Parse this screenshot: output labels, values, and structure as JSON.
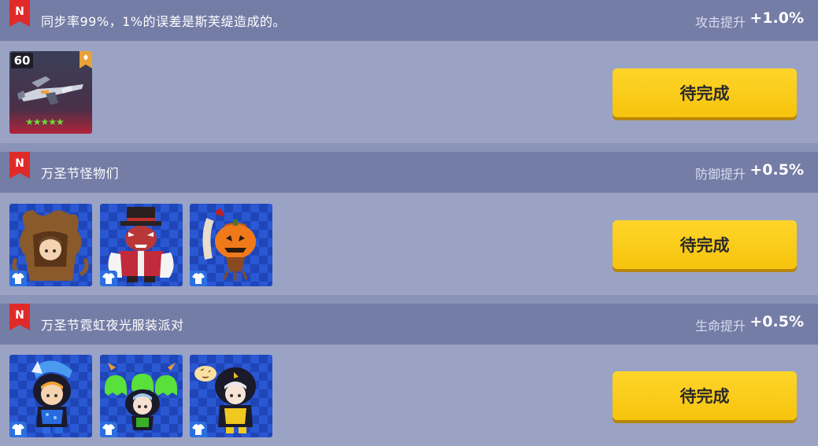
{
  "colors": {
    "header": "#737da6",
    "body": "#9aa3c4",
    "button": "#ffd52a",
    "flag": "#e02a2a"
  },
  "flag_letter": "N",
  "tasks": [
    {
      "title": "同步率99%，1%的误差是斯芙缇造成的。",
      "bonus_label": "攻击提升",
      "bonus_value": "+1.0%",
      "button_label": "待完成",
      "item": {
        "level": "60",
        "stars": "★★★★★",
        "icon": "weapon-icon"
      }
    },
    {
      "title": "万圣节怪物们",
      "bonus_label": "防御提升",
      "bonus_value": "+0.5%",
      "button_label": "待完成",
      "items": [
        "tree-monster-costume-icon",
        "top-hat-demon-costume-icon",
        "pumpkin-head-costume-icon"
      ]
    },
    {
      "title": "万圣节霓虹夜光服装派对",
      "bonus_label": "生命提升",
      "bonus_value": "+0.5%",
      "button_label": "待完成",
      "items": [
        "blue-hood-costume-icon",
        "green-ghost-costume-icon",
        "black-bird-costume-icon"
      ]
    }
  ]
}
